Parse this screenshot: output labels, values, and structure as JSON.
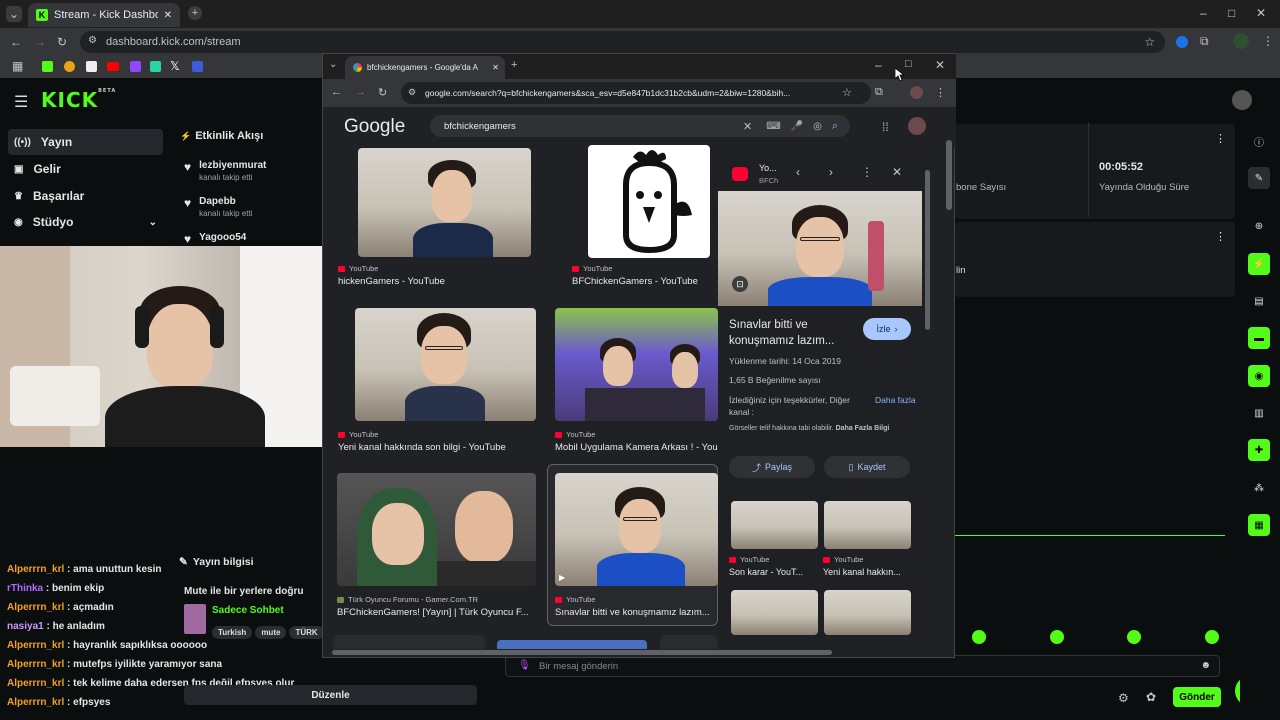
{
  "outer_browser": {
    "tab_title": "Stream - Kick Dashboard",
    "url": "dashboard.kick.com/stream"
  },
  "kick": {
    "logo": "KICK",
    "logo_badge": "BETA",
    "sidebar": [
      {
        "label": "Yayın",
        "icon": "broadcast-icon"
      },
      {
        "label": "Gelir",
        "icon": "revenue-icon"
      },
      {
        "label": "Başarılar",
        "icon": "achievements-icon"
      },
      {
        "label": "Stüdyo",
        "icon": "studio-icon"
      }
    ],
    "activity": {
      "title": "Etkinlik Akışı",
      "items": [
        {
          "name": "lezbiyenmurat",
          "action": "kanalı takip etti"
        },
        {
          "name": "Dapebb",
          "action": "kanalı takip etti"
        },
        {
          "name": "Yagooo54",
          "action": ""
        }
      ]
    },
    "stats": {
      "subs_label": "bone Sayısı",
      "uptime_value": "00:05:52",
      "uptime_label": "Yayında Olduğu Süre",
      "partial_text": "lin"
    },
    "stream_info": {
      "title": "Yayın bilgisi",
      "stream_title": "Mute ile bir yerlere doğru",
      "category": "Sadece Sohbet",
      "tags": [
        "Turkish",
        "mute",
        "TÜRK"
      ],
      "edit_button": "Düzenle"
    },
    "chat": [
      {
        "user": "Alperrrn_krl",
        "msg": "ama unuttun kesin",
        "color": "#f4a020"
      },
      {
        "user": "rThinka",
        "msg": "benim ekip",
        "color": "#b06cff"
      },
      {
        "user": "Alperrrn_krl",
        "msg": "açmadın",
        "color": "#f4a020"
      },
      {
        "user": "nasiya1",
        "msg": "he anladım",
        "color": "#c99aff"
      },
      {
        "user": "Alperrrn_krl",
        "msg": "hayranlık sapıklıksa oooooo",
        "color": "#f4a020"
      },
      {
        "user": "Alperrrn_krl",
        "msg": "mutefps iyilikte yaramıyor sana",
        "color": "#f4a020"
      },
      {
        "user": "Alperrrn_krl",
        "msg": "tek kelime daha edersen fps değil efpsyes olur",
        "color": "#f4a020"
      },
      {
        "user": "Alperrrn_krl",
        "msg": "efpsyes",
        "color": "#f4a020"
      }
    ],
    "chat_input_placeholder": "Bir mesaj gönderin",
    "send_button": "Gönder"
  },
  "google_window": {
    "tab_title": "bfchickengamers - Google'da A",
    "url": "google.com/search?q=bfchickengamers&sca_esv=d5e847b1dc31b2cb&udm=2&biw=1280&bih...",
    "logo": "Google",
    "query": "bfchickengamers",
    "results": [
      {
        "source": "YouTube",
        "title": "hickenGamers - YouTube"
      },
      {
        "source": "YouTube",
        "title": "BFChickenGamers - YouTube"
      },
      {
        "source": "YouTube",
        "title": "Yeni kanal hakkında son bilgi - YouTube"
      },
      {
        "source": "YouTube",
        "title": "Mobil Uygulama Kamera Arkası ! - You"
      },
      {
        "source": "Türk Oyuncu Forumu - Gamer.Com.TR",
        "title": "BFChickenGamers! [Yayın] | Türk Oyuncu F..."
      },
      {
        "source": "YouTube",
        "title": "Sınavlar bitti ve konuşmamız lazım..."
      }
    ],
    "panel": {
      "source_short": "Yo...",
      "source_sub": "BFCh",
      "title": "Sınavlar bitti ve konuşmamız lazım...",
      "watch": "İzle",
      "upload": "Yüklenme tarihi: 14 Oca 2019",
      "likes": "1,65 B Beğenilme sayısı",
      "desc": "İzlediğiniz için teşekkürler, Diğer kanal :",
      "more": "Daha fazla",
      "copyright": "Görseller telif hakkına tabi olabilir.",
      "copyright_more": "Daha Fazla Bilgi",
      "share": "Paylaş",
      "save": "Kaydet",
      "related": [
        {
          "source": "YouTube",
          "title": "Son karar - YouT..."
        },
        {
          "source": "YouTube",
          "title": "Yeni kanal hakkın..."
        }
      ]
    }
  }
}
